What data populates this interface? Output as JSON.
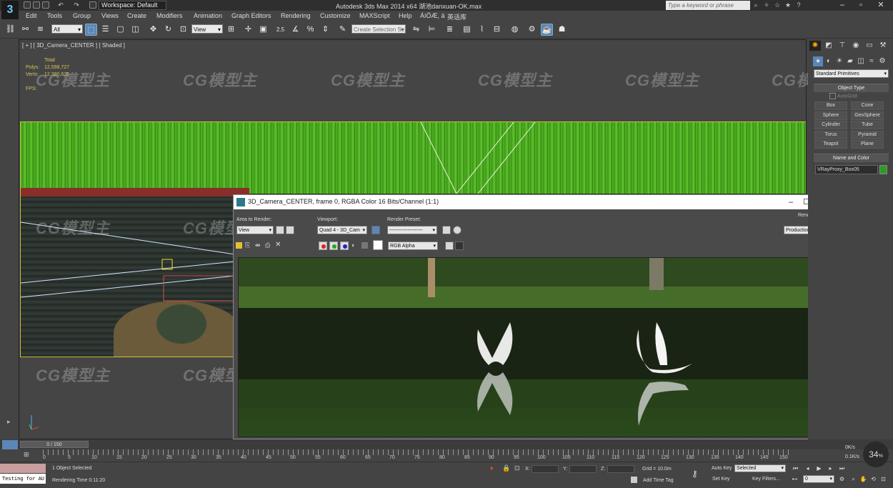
{
  "window": {
    "title": "Autodesk 3ds Max  2014 x64     湖池danxuan-OK.max",
    "workspace": "Workspace: Default",
    "search_placeholder": "Type a keyword or phrase",
    "app_logo": "3"
  },
  "menu": [
    "Edit",
    "Tools",
    "Group",
    "Views",
    "Create",
    "Modifiers",
    "Animation",
    "Graph Editors",
    "Rendering",
    "Customize",
    "MAXScript",
    "Help",
    "ÁíÖÆ, ä",
    "英话库"
  ],
  "toolbar": {
    "filter_dropdown": "All",
    "ref_coord_dropdown": "View",
    "snap_label": "2.5",
    "percent_snap_label": "%",
    "selection_set_placeholder": "Create Selection Se"
  },
  "viewport": {
    "label": "[ + ] [ 3D_Camera_CENTER ] [ Shaded ]",
    "stats": {
      "header": "Total",
      "polys_label": "Polys:",
      "polys_value": "12,598,727",
      "verts_label": "Verts:",
      "verts_value": "12,380,626",
      "fps_label": "FPS:"
    },
    "watermark": "CG模型主"
  },
  "render_window": {
    "title": "3D_Camera_CENTER, frame 0, RGBA Color 16 Bits/Channel (1:1)",
    "area_label": "Area to Render:",
    "area_value": "View",
    "viewport_label": "Viewport:",
    "viewport_value": "Quad 4 - 3D_Cam",
    "preset_label": "Render Preset:",
    "preset_value": "--------------------",
    "render_label": "Render",
    "render_value": "Production",
    "channel_value": "RGB Alpha"
  },
  "command_panel": {
    "category_dropdown": "Standard Primitives",
    "object_type_header": "Object Type",
    "autogrid_label": "AutoGrid",
    "object_buttons": [
      "Box",
      "Cone",
      "Sphere",
      "GeoSphere",
      "Cylinder",
      "Tube",
      "Torus",
      "Pyramid",
      "Teapot",
      "Plane"
    ],
    "name_color_header": "Name and Color",
    "object_name": "VRayProxy_Box05",
    "object_color": "#2f9a27"
  },
  "timeline": {
    "slider_label": "0 / 150",
    "ticks": [
      "0",
      "5",
      "10",
      "15",
      "20",
      "25",
      "30",
      "35",
      "40",
      "45",
      "50",
      "55",
      "60",
      "65",
      "70",
      "75",
      "80",
      "85",
      "90",
      "95",
      "100",
      "105",
      "110",
      "115",
      "120",
      "125",
      "130",
      "135",
      "140",
      "145",
      "150"
    ]
  },
  "status": {
    "maxscript_text": "Testing for AU",
    "selection_text": "1 Object Selected",
    "render_time_label": "Rendering Time  0:11:20",
    "x_label": "X:",
    "y_label": "Y:",
    "z_label": "Z:",
    "grid_label": "Grid = 10.0m",
    "auto_key": "Auto Key",
    "selected_dropdown": "Selected",
    "set_key": "Set Key",
    "key_filters": "Key Filters...",
    "add_time_tag": "Add Time Tag",
    "frame_value": "0",
    "zoom_badge": "34",
    "net_up": "0K/s",
    "net_down": "0.1K/s"
  }
}
